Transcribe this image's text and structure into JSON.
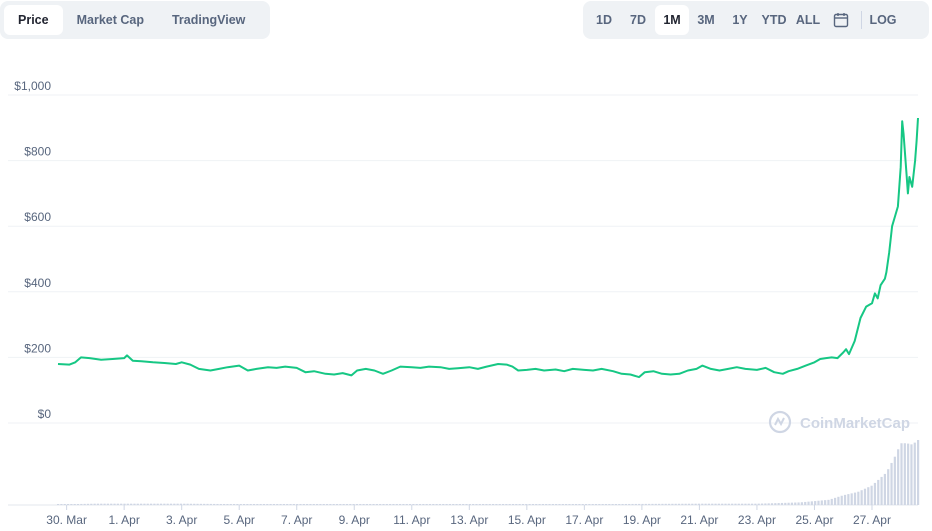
{
  "tabs": [
    {
      "label": "Price",
      "active": true
    },
    {
      "label": "Market Cap",
      "active": false
    },
    {
      "label": "TradingView",
      "active": false
    }
  ],
  "ranges": [
    {
      "label": "1D",
      "active": false
    },
    {
      "label": "7D",
      "active": false
    },
    {
      "label": "1M",
      "active": true
    },
    {
      "label": "3M",
      "active": false
    },
    {
      "label": "1Y",
      "active": false
    },
    {
      "label": "YTD",
      "active": false
    },
    {
      "label": "ALL",
      "active": false
    }
  ],
  "log_label": "LOG",
  "calendar_icon": "calendar-icon",
  "watermark": "CoinMarketCap",
  "colors": {
    "line": "#16c784",
    "volume": "#cfd6e4",
    "grid": "#eff2f5",
    "text": "#58667e",
    "active_text": "#222531"
  },
  "chart_data": {
    "type": "line",
    "title": "",
    "xlabel": "",
    "ylabel": "",
    "ylim": [
      0,
      1000
    ],
    "y_ticks": [
      {
        "value": 0,
        "label": "$0"
      },
      {
        "value": 200,
        "label": "$200"
      },
      {
        "value": 400,
        "label": "$400"
      },
      {
        "value": 600,
        "label": "$600"
      },
      {
        "value": 800,
        "label": "$800"
      },
      {
        "value": 1000,
        "label": "$1,000"
      }
    ],
    "x_ticks": [
      "30. Mar",
      "1. Apr",
      "3. Apr",
      "5. Apr",
      "7. Apr",
      "9. Apr",
      "11. Apr",
      "13. Apr",
      "15. Apr",
      "17. Apr",
      "19. Apr",
      "21. Apr",
      "23. Apr",
      "25. Apr",
      "27. Apr"
    ],
    "x_tick_days": [
      0,
      2,
      4,
      6,
      8,
      10,
      12,
      14,
      16,
      18,
      20,
      22,
      24,
      26,
      28
    ],
    "xlim_days": [
      -0.3,
      29.6
    ],
    "grid": true,
    "series": [
      {
        "price_points": [
          [
            -0.3,
            180
          ],
          [
            0.1,
            178
          ],
          [
            0.3,
            185
          ],
          [
            0.5,
            200
          ],
          [
            0.8,
            198
          ],
          [
            1.2,
            193
          ],
          [
            1.6,
            195
          ],
          [
            2.0,
            198
          ],
          [
            2.1,
            206
          ],
          [
            2.3,
            190
          ],
          [
            2.6,
            188
          ],
          [
            3.0,
            185
          ],
          [
            3.4,
            183
          ],
          [
            3.8,
            180
          ],
          [
            4.0,
            185
          ],
          [
            4.3,
            178
          ],
          [
            4.6,
            165
          ],
          [
            5.0,
            160
          ],
          [
            5.3,
            165
          ],
          [
            5.6,
            170
          ],
          [
            6.0,
            175
          ],
          [
            6.3,
            160
          ],
          [
            6.6,
            165
          ],
          [
            7.0,
            170
          ],
          [
            7.3,
            168
          ],
          [
            7.6,
            172
          ],
          [
            8.0,
            168
          ],
          [
            8.3,
            155
          ],
          [
            8.6,
            158
          ],
          [
            9.0,
            150
          ],
          [
            9.3,
            148
          ],
          [
            9.6,
            152
          ],
          [
            9.9,
            145
          ],
          [
            10.1,
            160
          ],
          [
            10.4,
            165
          ],
          [
            10.7,
            160
          ],
          [
            11.0,
            150
          ],
          [
            11.3,
            160
          ],
          [
            11.6,
            172
          ],
          [
            12.0,
            170
          ],
          [
            12.3,
            168
          ],
          [
            12.6,
            172
          ],
          [
            13.0,
            170
          ],
          [
            13.3,
            165
          ],
          [
            13.6,
            167
          ],
          [
            14.0,
            170
          ],
          [
            14.3,
            165
          ],
          [
            14.6,
            172
          ],
          [
            15.0,
            180
          ],
          [
            15.3,
            178
          ],
          [
            15.5,
            172
          ],
          [
            15.7,
            160
          ],
          [
            16.0,
            162
          ],
          [
            16.3,
            165
          ],
          [
            16.6,
            160
          ],
          [
            17.0,
            163
          ],
          [
            17.3,
            158
          ],
          [
            17.6,
            165
          ],
          [
            18.0,
            162
          ],
          [
            18.3,
            160
          ],
          [
            18.6,
            165
          ],
          [
            19.0,
            158
          ],
          [
            19.3,
            150
          ],
          [
            19.6,
            148
          ],
          [
            19.9,
            140
          ],
          [
            20.1,
            155
          ],
          [
            20.4,
            158
          ],
          [
            20.7,
            150
          ],
          [
            21.0,
            148
          ],
          [
            21.3,
            150
          ],
          [
            21.6,
            160
          ],
          [
            21.9,
            165
          ],
          [
            22.1,
            175
          ],
          [
            22.4,
            165
          ],
          [
            22.7,
            160
          ],
          [
            23.0,
            165
          ],
          [
            23.3,
            170
          ],
          [
            23.6,
            165
          ],
          [
            24.0,
            162
          ],
          [
            24.3,
            168
          ],
          [
            24.6,
            155
          ],
          [
            24.9,
            150
          ],
          [
            25.1,
            158
          ],
          [
            25.4,
            165
          ],
          [
            25.7,
            175
          ],
          [
            26.0,
            185
          ],
          [
            26.2,
            195
          ],
          [
            26.4,
            198
          ],
          [
            26.6,
            200
          ],
          [
            26.8,
            198
          ],
          [
            27.0,
            215
          ],
          [
            27.1,
            225
          ],
          [
            27.2,
            210
          ],
          [
            27.4,
            250
          ],
          [
            27.6,
            320
          ],
          [
            27.8,
            355
          ],
          [
            28.0,
            365
          ],
          [
            28.1,
            395
          ],
          [
            28.2,
            380
          ],
          [
            28.3,
            420
          ],
          [
            28.45,
            440
          ],
          [
            28.5,
            460
          ],
          [
            28.6,
            520
          ],
          [
            28.7,
            600
          ],
          [
            28.8,
            630
          ],
          [
            28.9,
            660
          ],
          [
            29.0,
            780
          ],
          [
            29.05,
            920
          ],
          [
            29.1,
            880
          ],
          [
            29.2,
            760
          ],
          [
            29.25,
            700
          ],
          [
            29.3,
            750
          ],
          [
            29.4,
            720
          ],
          [
            29.5,
            800
          ],
          [
            29.55,
            860
          ],
          [
            29.6,
            930
          ]
        ]
      }
    ],
    "volume_points": [
      [
        -0.3,
        0.01
      ],
      [
        1.0,
        0.02
      ],
      [
        4.0,
        0.02
      ],
      [
        7.0,
        0.01
      ],
      [
        10.0,
        0.01
      ],
      [
        13.0,
        0.015
      ],
      [
        16.0,
        0.01
      ],
      [
        19.0,
        0.015
      ],
      [
        22.0,
        0.02
      ],
      [
        24.0,
        0.02
      ],
      [
        25.5,
        0.04
      ],
      [
        26.5,
        0.08
      ],
      [
        27.0,
        0.15
      ],
      [
        27.5,
        0.2
      ],
      [
        28.0,
        0.3
      ],
      [
        28.5,
        0.5
      ],
      [
        28.8,
        0.75
      ],
      [
        29.0,
        0.95
      ],
      [
        29.2,
        0.95
      ],
      [
        29.4,
        0.93
      ],
      [
        29.6,
        1.0
      ]
    ]
  }
}
